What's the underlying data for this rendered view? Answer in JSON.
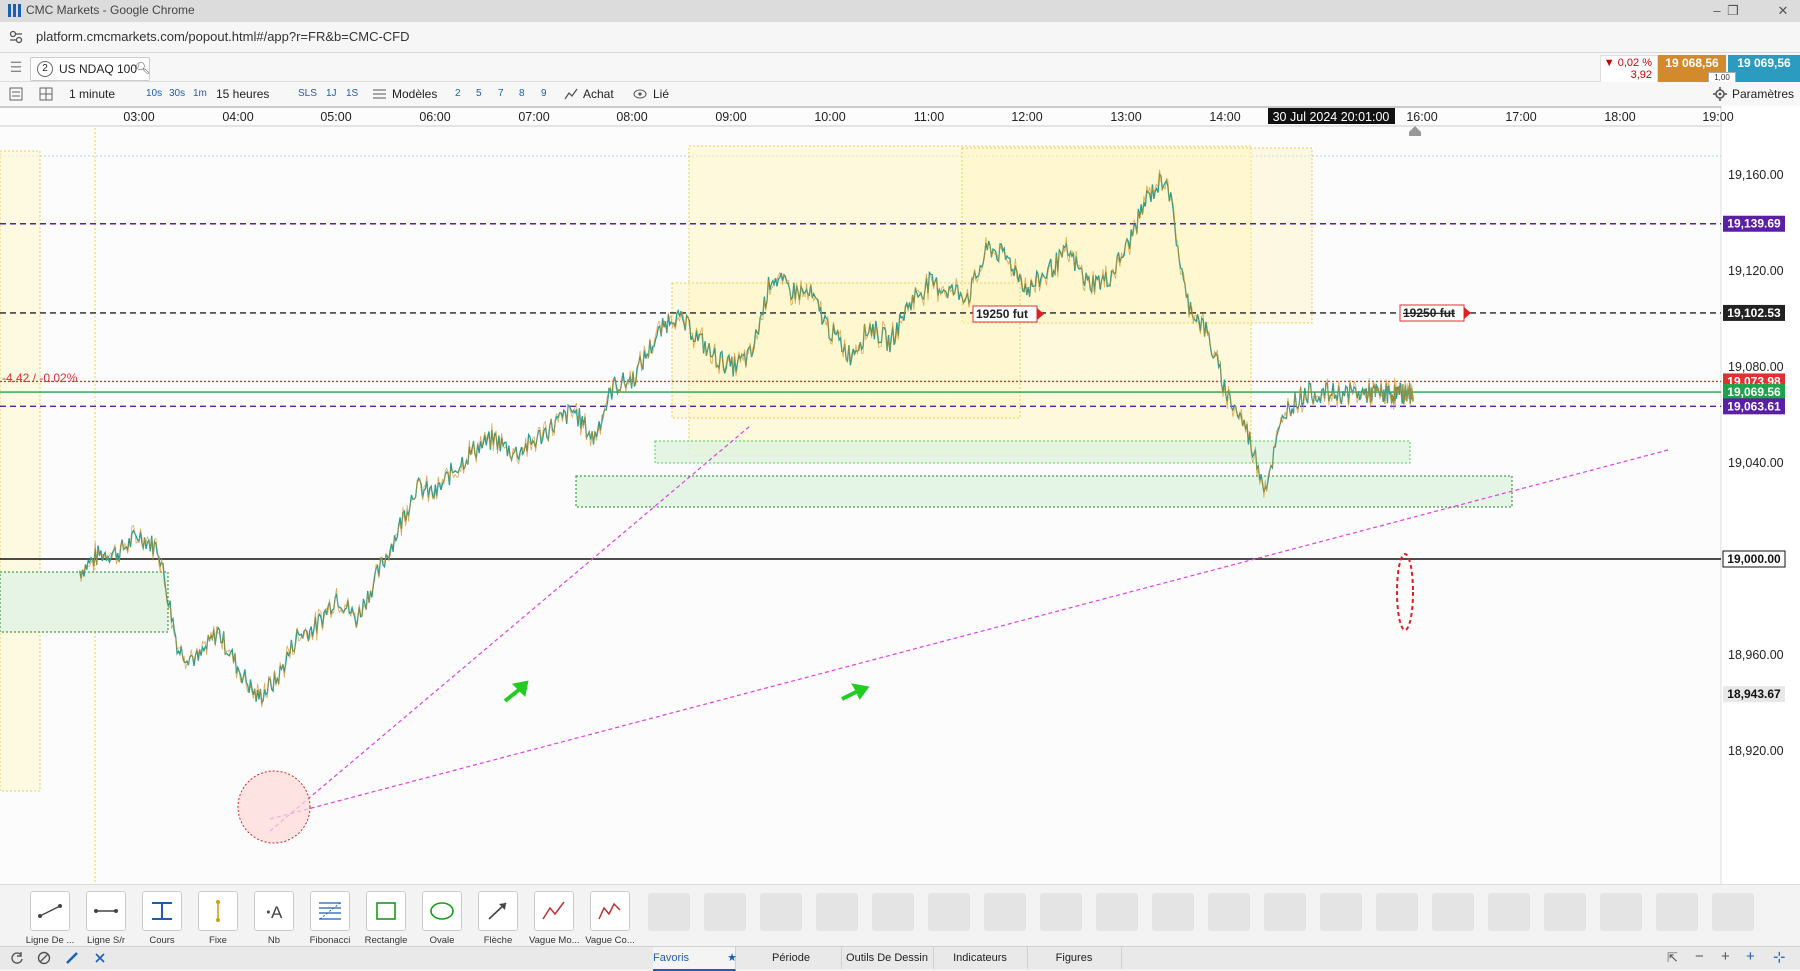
{
  "browser": {
    "window_title": "CMC Markets - Google Chrome",
    "url": "platform.cmcmarkets.com/popout.html#/app?r=FR&b=CMC-CFD"
  },
  "instrument": {
    "tab_number": "2",
    "name": "US NDAQ 100",
    "change_pct": "▼ 0,02 %",
    "change_pts": "3,92",
    "sell_price": "19 068,56",
    "buy_price": "19 069,56",
    "spread": "1,00"
  },
  "toolbar": {
    "interval": "1 minute",
    "quick_intervals": [
      "10s",
      "30s",
      "1m"
    ],
    "range": "15 heures",
    "quick_ranges": [
      "SLS",
      "1J",
      "1S"
    ],
    "templates": "Modèles",
    "numbers": [
      "2",
      "5",
      "7",
      "8",
      "9"
    ],
    "trade": "Achat",
    "link": "Lié",
    "settings": "Paramètres"
  },
  "chart_data": {
    "type": "line",
    "style": "candlestick (approximated as line)",
    "instrument": "US NDAQ 100",
    "interval": "1 minute",
    "x_labels": [
      "03:00",
      "04:00",
      "05:00",
      "06:00",
      "07:00",
      "08:00",
      "09:00",
      "10:00",
      "11:00",
      "12:00",
      "13:00",
      "14:00",
      "30 Jul 2024 20:01:00",
      "16:00",
      "17:00",
      "18:00",
      "19:00"
    ],
    "y_ticks": [
      "19,160.00",
      "19,120.00",
      "19,080.00",
      "19,040.00",
      "19,000.00",
      "18,960.00",
      "18,920.00"
    ],
    "ylim": [
      18915,
      19190
    ],
    "price_series": {
      "t": [
        2.4,
        2.6,
        2.8,
        3.0,
        3.2,
        3.4,
        3.6,
        3.8,
        4.0,
        4.2,
        4.4,
        4.6,
        4.8,
        5.0,
        5.2,
        5.4,
        5.6,
        5.8,
        6.0,
        6.2,
        6.4,
        6.6,
        6.8,
        7.0,
        7.2,
        7.4,
        7.6,
        7.8,
        8.0,
        8.2,
        8.4,
        8.6,
        8.8,
        9.0,
        9.2,
        9.4,
        9.6,
        9.8,
        10.0,
        10.2,
        10.4,
        10.6,
        10.8,
        11.0,
        11.2,
        11.4,
        11.6,
        11.8,
        12.0,
        12.2,
        12.4,
        12.6,
        12.8,
        13.0,
        13.2,
        13.4,
        13.6,
        13.8,
        14.0,
        14.2,
        14.4,
        14.6,
        14.8,
        15.0,
        15.2,
        15.4,
        15.5,
        15.6,
        15.7,
        15.8,
        15.85,
        15.9
      ],
      "price": [
        18995,
        19002,
        19003,
        19010,
        19004,
        18962,
        18958,
        18970,
        18955,
        18942,
        18950,
        18968,
        18972,
        18985,
        18975,
        18992,
        19010,
        19030,
        19027,
        19038,
        19046,
        19050,
        19044,
        19049,
        19056,
        19062,
        19050,
        19072,
        19075,
        19090,
        19102,
        19095,
        19085,
        19080,
        19085,
        19118,
        19112,
        19110,
        19095,
        19085,
        19097,
        19090,
        19107,
        19115,
        19112,
        19110,
        19130,
        19125,
        19112,
        19120,
        19128,
        19115,
        19116,
        19130,
        19150,
        19160,
        19108,
        19095,
        19070,
        19055,
        19030,
        19062,
        19069,
        19069,
        19069,
        19069,
        19069,
        19069,
        19069,
        19069,
        19069,
        19069
      ]
    },
    "levels": [
      {
        "label": "19,139.69",
        "value": 19139.69,
        "color": "#5b1fa6",
        "style": "dashed"
      },
      {
        "label": "19,102.53",
        "value": 19102.53,
        "color": "#222222",
        "style": "dashed"
      },
      {
        "label": "19,073.98",
        "value": 19073.98,
        "color": "#e03030",
        "style": "dotted"
      },
      {
        "label": "19,069.56",
        "value": 19069.56,
        "color": "#1ea34a",
        "style": "solid"
      },
      {
        "label": "19,063.61",
        "value": 19063.61,
        "color": "#5b1fa6",
        "style": "dashed"
      },
      {
        "label": "19,000.00",
        "value": 19000.0,
        "color": "#111111",
        "style": "solid"
      },
      {
        "label": "18,943.67",
        "value": 18943.67,
        "color": "#333333",
        "style": "none"
      }
    ],
    "annotations": [
      "-4.42 / -0.02%",
      "19250 fut",
      "19250 fut"
    ],
    "current_price": 19069.56
  },
  "drawing_tools": [
    "Ligne De ...",
    "Ligne S/r",
    "Cours",
    "Fixe",
    "Nb",
    "Fibonacci",
    "Rectangle",
    "Ovale",
    "Flèche",
    "Vague Mo...",
    "Vague Co..."
  ],
  "bottom_tabs": [
    "Favoris",
    "Période",
    "Outils De Dessin",
    "Indicateurs",
    "Figures"
  ],
  "colors": {
    "accent": "#1a5fb4",
    "sell": "#d38a2a",
    "buy": "#2b9bbf",
    "up": "#2a9d8f",
    "down": "#d08a1a"
  }
}
